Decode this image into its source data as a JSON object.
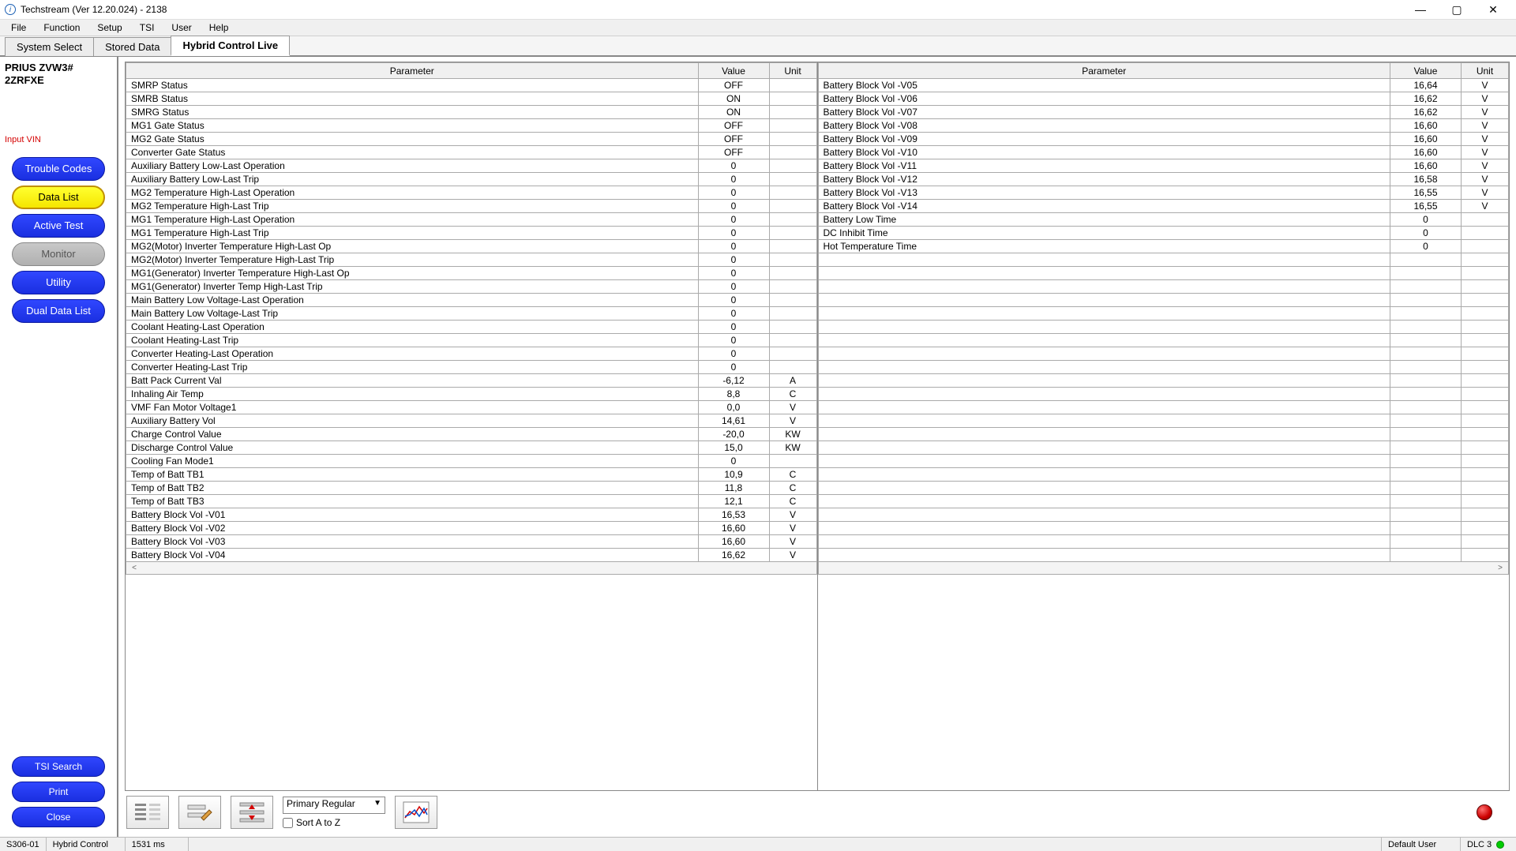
{
  "window": {
    "title": "Techstream (Ver 12.20.024) - 2138"
  },
  "menu": [
    "File",
    "Function",
    "Setup",
    "TSI",
    "User",
    "Help"
  ],
  "tabs": [
    "System Select",
    "Stored Data",
    "Hybrid Control Live"
  ],
  "active_tab": 2,
  "vehicle": {
    "line1": "PRIUS ZVW3#",
    "line2": "2ZRFXE"
  },
  "input_vin_label": "Input VIN",
  "side_buttons": [
    {
      "label": "Trouble Codes",
      "style": "blue"
    },
    {
      "label": "Data List",
      "style": "yellow"
    },
    {
      "label": "Active Test",
      "style": "blue"
    },
    {
      "label": "Monitor",
      "style": "gray"
    },
    {
      "label": "Utility",
      "style": "blue"
    },
    {
      "label": "Dual Data List",
      "style": "blue"
    }
  ],
  "side_buttons_bottom": [
    {
      "label": "TSI Search",
      "style": "blue"
    },
    {
      "label": "Print",
      "style": "blue"
    },
    {
      "label": "Close",
      "style": "blue"
    }
  ],
  "headers": {
    "param": "Parameter",
    "value": "Value",
    "unit": "Unit"
  },
  "left_rows": [
    {
      "p": "SMRP Status",
      "v": "OFF",
      "u": ""
    },
    {
      "p": "SMRB Status",
      "v": "ON",
      "u": ""
    },
    {
      "p": "SMRG Status",
      "v": "ON",
      "u": ""
    },
    {
      "p": "MG1 Gate Status",
      "v": "OFF",
      "u": ""
    },
    {
      "p": "MG2 Gate Status",
      "v": "OFF",
      "u": ""
    },
    {
      "p": "Converter Gate Status",
      "v": "OFF",
      "u": ""
    },
    {
      "p": "Auxiliary Battery Low-Last Operation",
      "v": "0",
      "u": ""
    },
    {
      "p": "Auxiliary Battery Low-Last Trip",
      "v": "0",
      "u": ""
    },
    {
      "p": "MG2 Temperature High-Last Operation",
      "v": "0",
      "u": ""
    },
    {
      "p": "MG2 Temperature High-Last Trip",
      "v": "0",
      "u": ""
    },
    {
      "p": "MG1 Temperature High-Last Operation",
      "v": "0",
      "u": ""
    },
    {
      "p": "MG1 Temperature High-Last Trip",
      "v": "0",
      "u": ""
    },
    {
      "p": "MG2(Motor) Inverter Temperature High-Last Op",
      "v": "0",
      "u": ""
    },
    {
      "p": "MG2(Motor) Inverter Temperature High-Last Trip",
      "v": "0",
      "u": ""
    },
    {
      "p": "MG1(Generator) Inverter Temperature High-Last Op",
      "v": "0",
      "u": ""
    },
    {
      "p": "MG1(Generator) Inverter Temp High-Last Trip",
      "v": "0",
      "u": ""
    },
    {
      "p": "Main Battery Low Voltage-Last Operation",
      "v": "0",
      "u": ""
    },
    {
      "p": "Main Battery Low Voltage-Last Trip",
      "v": "0",
      "u": ""
    },
    {
      "p": "Coolant Heating-Last Operation",
      "v": "0",
      "u": ""
    },
    {
      "p": "Coolant Heating-Last Trip",
      "v": "0",
      "u": ""
    },
    {
      "p": "Converter Heating-Last Operation",
      "v": "0",
      "u": ""
    },
    {
      "p": "Converter Heating-Last Trip",
      "v": "0",
      "u": ""
    },
    {
      "p": "Batt Pack Current Val",
      "v": "-6,12",
      "u": "A"
    },
    {
      "p": "Inhaling Air Temp",
      "v": "8,8",
      "u": "C"
    },
    {
      "p": "VMF Fan Motor Voltage1",
      "v": "0,0",
      "u": "V"
    },
    {
      "p": "Auxiliary Battery Vol",
      "v": "14,61",
      "u": "V"
    },
    {
      "p": "Charge Control Value",
      "v": "-20,0",
      "u": "KW"
    },
    {
      "p": "Discharge Control Value",
      "v": "15,0",
      "u": "KW"
    },
    {
      "p": "Cooling Fan Mode1",
      "v": "0",
      "u": ""
    },
    {
      "p": "Temp of Batt TB1",
      "v": "10,9",
      "u": "C"
    },
    {
      "p": "Temp of Batt TB2",
      "v": "11,8",
      "u": "C"
    },
    {
      "p": "Temp of Batt TB3",
      "v": "12,1",
      "u": "C"
    },
    {
      "p": "Battery Block Vol -V01",
      "v": "16,53",
      "u": "V"
    },
    {
      "p": "Battery Block Vol -V02",
      "v": "16,60",
      "u": "V"
    },
    {
      "p": "Battery Block Vol -V03",
      "v": "16,60",
      "u": "V"
    },
    {
      "p": "Battery Block Vol -V04",
      "v": "16,62",
      "u": "V"
    }
  ],
  "right_rows": [
    {
      "p": "Battery Block Vol -V05",
      "v": "16,64",
      "u": "V"
    },
    {
      "p": "Battery Block Vol -V06",
      "v": "16,62",
      "u": "V"
    },
    {
      "p": "Battery Block Vol -V07",
      "v": "16,62",
      "u": "V"
    },
    {
      "p": "Battery Block Vol -V08",
      "v": "16,60",
      "u": "V"
    },
    {
      "p": "Battery Block Vol -V09",
      "v": "16,60",
      "u": "V"
    },
    {
      "p": "Battery Block Vol -V10",
      "v": "16,60",
      "u": "V"
    },
    {
      "p": "Battery Block Vol -V11",
      "v": "16,60",
      "u": "V"
    },
    {
      "p": "Battery Block Vol -V12",
      "v": "16,58",
      "u": "V"
    },
    {
      "p": "Battery Block Vol -V13",
      "v": "16,55",
      "u": "V"
    },
    {
      "p": "Battery Block Vol -V14",
      "v": "16,55",
      "u": "V"
    },
    {
      "p": "Battery Low Time",
      "v": "0",
      "u": ""
    },
    {
      "p": "DC Inhibit Time",
      "v": "0",
      "u": ""
    },
    {
      "p": "Hot Temperature Time",
      "v": "0",
      "u": ""
    }
  ],
  "right_empty_rows": 23,
  "dropdown_value": "Primary Regular",
  "sort_label": "Sort A to Z",
  "status": {
    "code": "S306-01",
    "system": "Hybrid Control",
    "ms": "1531 ms",
    "user": "Default User",
    "dlc": "DLC 3"
  }
}
